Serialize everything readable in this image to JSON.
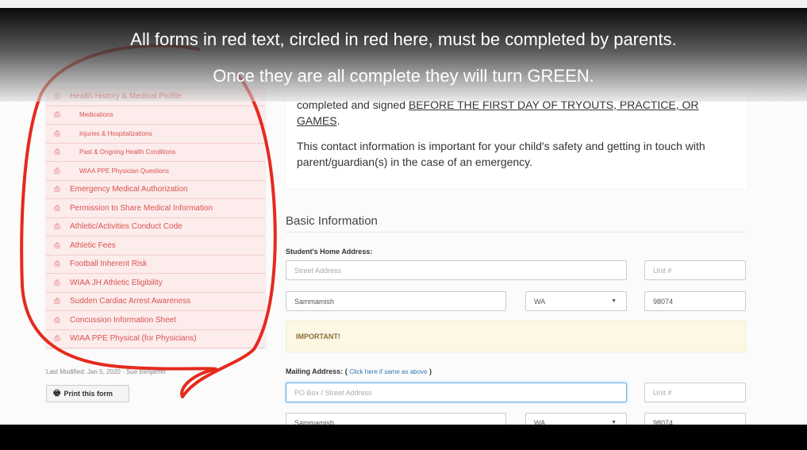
{
  "caption": {
    "line1": "All forms in red text, circled in red here, must be completed by parents.",
    "line2": "Once they are all complete they will turn GREEN."
  },
  "sidebar": {
    "items": [
      {
        "label": "Health History & Medical Profile",
        "icon": "pdf-icon",
        "sub": false
      },
      {
        "label": "Medications",
        "icon": "pdf-icon",
        "sub": true
      },
      {
        "label": "Injuries & Hospitalizations",
        "icon": "pdf-icon",
        "sub": true
      },
      {
        "label": "Past & Ongoing Health Conditions",
        "icon": "pdf-icon",
        "sub": true
      },
      {
        "label": "WIAA PPE Physician Questions",
        "icon": "pdf-icon",
        "sub": true
      },
      {
        "label": "Emergency Medical Authorization",
        "icon": "pdf-icon",
        "sub": false
      },
      {
        "label": "Permission to Share Medical Information",
        "icon": "pdf-icon",
        "sub": false
      },
      {
        "label": "Athletic/Activities Conduct Code",
        "icon": "pdf-icon",
        "sub": false
      },
      {
        "label": "Athletic Fees",
        "icon": "pdf-icon",
        "sub": false
      },
      {
        "label": "Football Inherent Risk",
        "icon": "pdf-icon",
        "sub": false
      },
      {
        "label": "WIAA JH Athletic Eligibility",
        "icon": "pdf-icon",
        "sub": false
      },
      {
        "label": "Sudden Cardiac Arrest Awareness",
        "icon": "pdf-icon",
        "sub": false
      },
      {
        "label": "Concussion Information Sheet",
        "icon": "pdf-icon",
        "sub": false
      },
      {
        "label": "WIAA PPE Physical (for Physicians)",
        "icon": "pdf-icon",
        "sub": false
      }
    ],
    "last_modified": "Last Modified: Jan 5, 2020 · Sue Benjamin",
    "print_label": "Print this form"
  },
  "main": {
    "info_line1_plain": "completed and signed ",
    "info_line1_underlined": "BEFORE THE FIRST DAY OF TRYOUTS, PRACTICE, OR GAMES",
    "info_line1_end": ".",
    "info_line2": "This contact information is important for your child's safety and getting in touch with parent/guardian(s) in the case of an emergency.",
    "section_title": "Basic Information",
    "home_address_label": "Student's Home Address:",
    "street_placeholder": "Street Address",
    "unit_placeholder": "Unit #",
    "city_value": "Sammamish",
    "state_value": "WA",
    "zip_value": "98074",
    "important_label": "IMPORTANT!",
    "mailing_label": "Mailing Address:",
    "mailing_bracket_open": "(",
    "mailing_link": "Click here if same as above",
    "mailing_bracket_close": ")",
    "mailing_placeholder": "PO Box / Street Address",
    "mailing_unit_placeholder": "Unit #",
    "mailing_city_value": "Sammamish",
    "mailing_state_value": "WA",
    "mailing_zip_value": "98074"
  },
  "colors": {
    "incomplete_text": "#d9534f",
    "incomplete_bg": "#fcecec",
    "circle": "#e52a1d",
    "alert_bg": "#fcf8e3"
  }
}
